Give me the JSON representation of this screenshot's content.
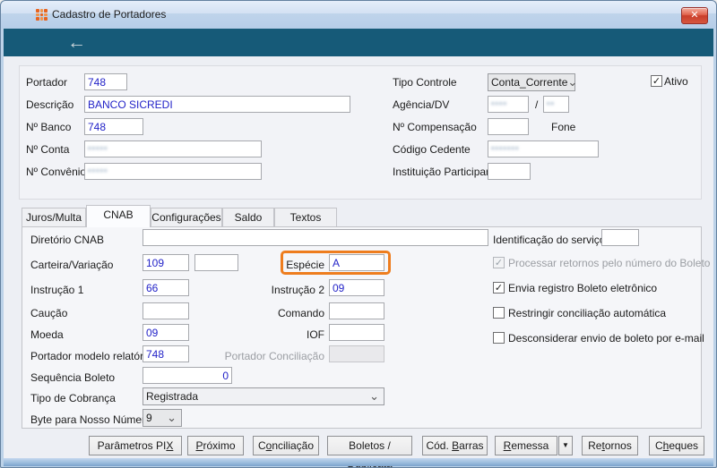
{
  "colors": {
    "header_teal": "#165a78",
    "highlight_orange": "#ee7d1e",
    "value_blue": "#2323c8",
    "close_red": "#d0493a"
  },
  "icons": {
    "close": "✕",
    "back_arrow": "←",
    "chevron_down": "⌄",
    "dropdown_arrow": "▼",
    "check": "✓"
  },
  "window": {
    "title": "Cadastro de Portadores"
  },
  "top_form": {
    "portador": {
      "label": "Portador",
      "value": "748"
    },
    "descricao": {
      "label": "Descrição",
      "value": "BANCO SICREDI"
    },
    "num_banco": {
      "label": "Nº Banco",
      "value": "748"
    },
    "num_conta": {
      "label": "Nº Conta",
      "value": "•••••",
      "redacted": true
    },
    "num_convenio": {
      "label": "Nº Convênio",
      "value": "•••••",
      "redacted": true
    },
    "tipo_controle": {
      "label": "Tipo Controle",
      "value": "Conta_Corrente"
    },
    "ativo": {
      "label": "Ativo",
      "checked": true
    },
    "agencia_dv": {
      "label": "Agência/DV",
      "value": "••••",
      "separator": "/",
      "dv": "••",
      "redacted": true
    },
    "num_compensacao": {
      "label": "Nº Compensação",
      "value": ""
    },
    "fone": {
      "label": "Fone"
    },
    "codigo_cedente": {
      "label": "Código Cedente",
      "value": "•••••••",
      "redacted": true
    },
    "instituicao_participante": {
      "label": "Instituição Participante",
      "value": ""
    }
  },
  "tabs": [
    {
      "label": "Juros/Multa",
      "active": false
    },
    {
      "label": "CNAB",
      "active": true
    },
    {
      "label": "Configurações",
      "active": false
    },
    {
      "label": "Saldo",
      "active": false
    },
    {
      "label": "Textos",
      "active": false
    }
  ],
  "cnab": {
    "diretorio_cnab": {
      "label": "Diretório CNAB",
      "value": ""
    },
    "carteira_variacao": {
      "label": "Carteira/Variação",
      "value1": "109",
      "value2": ""
    },
    "especie": {
      "label": "Espécie",
      "value": "A",
      "highlighted": true
    },
    "instrucao1": {
      "label": "Instrução 1",
      "value": "66"
    },
    "instrucao2": {
      "label": "Instrução 2",
      "value": "09"
    },
    "caucao": {
      "label": "Caução",
      "value": ""
    },
    "comando": {
      "label": "Comando",
      "value": ""
    },
    "moeda": {
      "label": "Moeda",
      "value": "09"
    },
    "iof": {
      "label": "IOF",
      "value": ""
    },
    "portador_modelo": {
      "label": "Portador modelo relatório",
      "value": "748"
    },
    "portador_conciliacao": {
      "label": "Portador Conciliação",
      "value": "",
      "disabled": true
    },
    "sequencia_boleto": {
      "label": "Sequência Boleto",
      "value": "0"
    },
    "tipo_cobranca": {
      "label": "Tipo de Cobrança",
      "value": "Registrada"
    },
    "byte_nosso_numero": {
      "label": "Byte para Nosso Número",
      "value": "9"
    },
    "identificacao_servico": {
      "label": "Identificação do serviço",
      "value": ""
    },
    "checkboxes": [
      {
        "label": "Processar retornos pelo número do Boleto",
        "checked": true,
        "disabled": true
      },
      {
        "label": "Envia registro Boleto eletrônico",
        "checked": true,
        "disabled": false
      },
      {
        "label": "Restringir conciliação automática",
        "checked": false,
        "disabled": false
      },
      {
        "label": "Desconsiderar envio de boleto por e-mail",
        "checked": false,
        "disabled": false
      }
    ]
  },
  "footer": {
    "buttons": [
      {
        "name": "parametros-pix",
        "pre": "Parâmetros PI",
        "key": "X",
        "post": ""
      },
      {
        "name": "proximo",
        "pre": "",
        "key": "P",
        "post": "róximo"
      },
      {
        "name": "conciliacao",
        "pre": "C",
        "key": "o",
        "post": "nciliação"
      },
      {
        "name": "boletos-duplicata",
        "pre": "Boletos / ",
        "key": "D",
        "post": "uplicata"
      },
      {
        "name": "cod-barras",
        "pre": "Cód. ",
        "key": "B",
        "post": "arras"
      },
      {
        "name": "remessa",
        "pre": "",
        "key": "R",
        "post": "emessa"
      },
      {
        "name": "retornos",
        "pre": "Re",
        "key": "t",
        "post": "ornos"
      },
      {
        "name": "cheques",
        "pre": "C",
        "key": "h",
        "post": "eques"
      }
    ]
  }
}
